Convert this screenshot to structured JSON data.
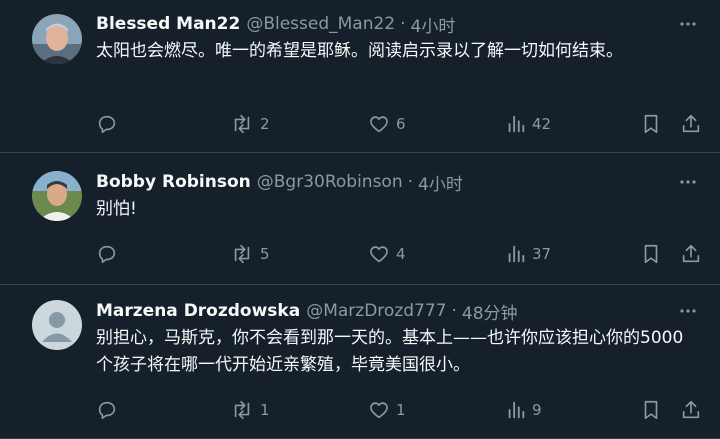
{
  "tweets": [
    {
      "name": "Blessed Man22",
      "handle": "@Blessed_Man22",
      "dot": "·",
      "time": "4小时",
      "text": "太阳也会燃尽。唯一的希望是耶稣。阅读启示录以了解一切如何结束。",
      "replies": "",
      "retweets": "2",
      "likes": "6",
      "views": "42",
      "avatar_icon": "user-photo-icon"
    },
    {
      "name": "Bobby Robinson",
      "handle": "@Bgr30Robinson",
      "dot": "·",
      "time": "4小时",
      "text": "别怕!",
      "replies": "",
      "retweets": "5",
      "likes": "4",
      "views": "37",
      "avatar_icon": "user-photo-icon"
    },
    {
      "name": "Marzena Drozdowska",
      "handle": "@MarzDrozd777",
      "dot": "·",
      "time": "48分钟",
      "text": "别担心，马斯克，你不会看到那一天的。基本上——也许你应该担心你的5000个孩子将在哪一代开始近亲繁殖，毕竟美国很小。",
      "replies": "",
      "retweets": "1",
      "likes": "1",
      "views": "9",
      "avatar_icon": "default-avatar-icon"
    }
  ],
  "colors": {
    "background": "#15202b",
    "muted": "#8b98a5",
    "text": "#f7f9f9",
    "divider": "#38444d"
  }
}
